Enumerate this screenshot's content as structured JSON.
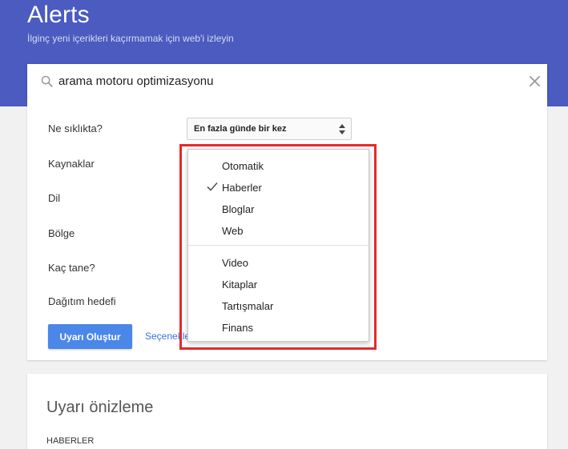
{
  "header": {
    "title": "Alerts",
    "subtitle": "İlginç yeni içerikleri kaçırmamak için web'i izleyin"
  },
  "search": {
    "value": "arama motoru optimizasyonu"
  },
  "options": {
    "frequency_label": "Ne sıklıkta?",
    "frequency_value": "En fazla günde bir kez",
    "sources_label": "Kaynaklar",
    "language_label": "Dil",
    "region_label": "Bölge",
    "how_many_label": "Kaç tane?",
    "delivery_label": "Dağıtım hedefi",
    "create_button": "Uyarı Oluştur",
    "options_link": "Seçenekle"
  },
  "sources_dropdown": {
    "group1": [
      {
        "label": "Otomatik",
        "checked": false
      },
      {
        "label": "Haberler",
        "checked": true
      },
      {
        "label": "Bloglar",
        "checked": false
      },
      {
        "label": "Web",
        "checked": false
      }
    ],
    "group2": [
      {
        "label": "Video",
        "checked": false
      },
      {
        "label": "Kitaplar",
        "checked": false
      },
      {
        "label": "Tartışmalar",
        "checked": false
      },
      {
        "label": "Finans",
        "checked": false
      }
    ]
  },
  "preview": {
    "title": "Uyarı önizleme",
    "section": "HABERLER"
  },
  "colors": {
    "header": "#4b5bc0",
    "button": "#4a87e8",
    "highlight": "#e42a2a"
  }
}
